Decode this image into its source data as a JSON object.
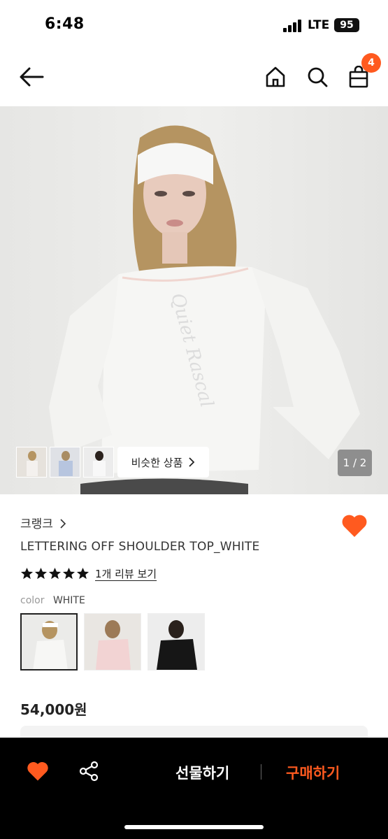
{
  "status_bar": {
    "time": "6:48",
    "network": "LTE",
    "battery": "95"
  },
  "header": {
    "cart_count": "4"
  },
  "gallery": {
    "similar_label": "비슷한 상품",
    "page_indicator": "1 / 2"
  },
  "product": {
    "brand": "크랭크",
    "name": "LETTERING OFF SHOULDER TOP_WHITE",
    "rating_stars": 5,
    "review_link": "1개 리뷰 보기",
    "color_label": "color",
    "color_value": "WHITE",
    "price": "54,000원"
  },
  "bottom_bar": {
    "gift_label": "선물하기",
    "buy_label": "구매하기"
  },
  "colors": {
    "accent": "#ff5a1f",
    "background_bar": "#000000"
  }
}
